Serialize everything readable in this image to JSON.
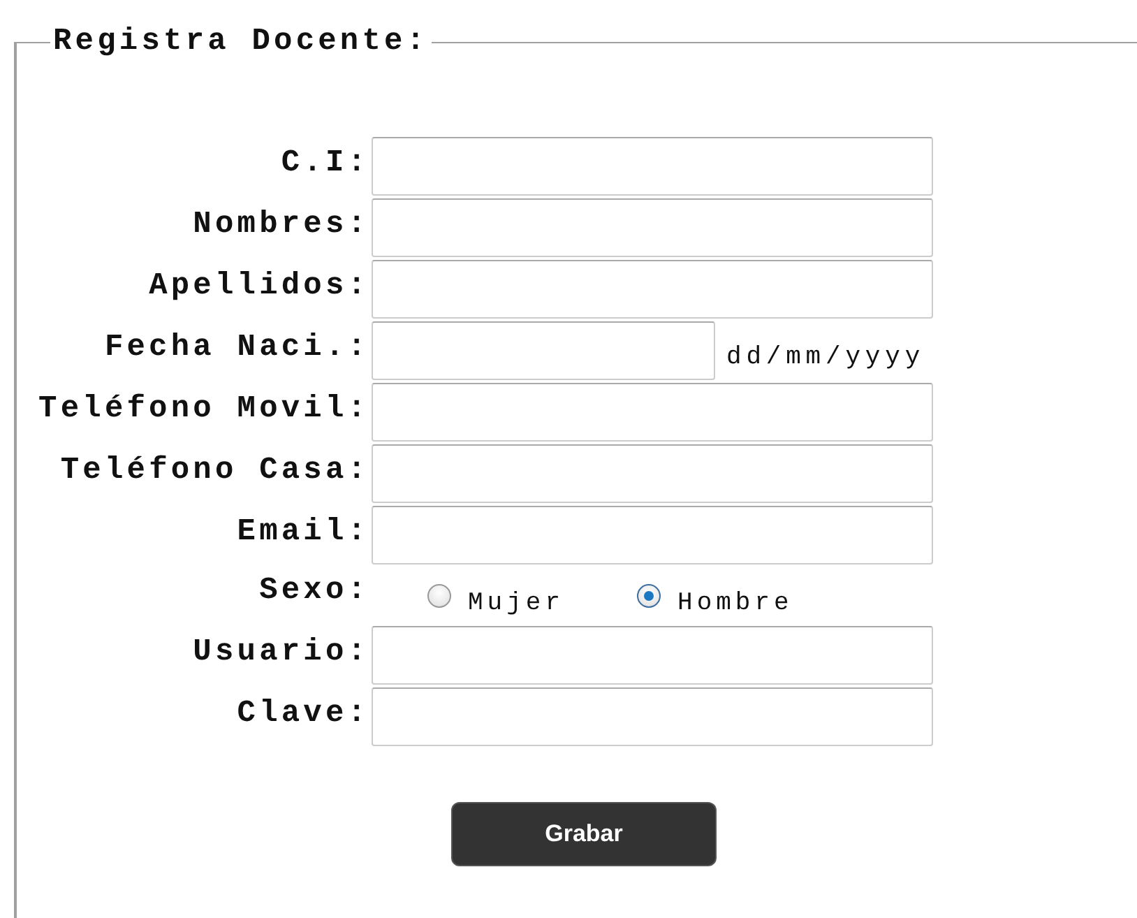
{
  "form": {
    "legend": "Registra Docente:",
    "fields": [
      {
        "kind": "text",
        "label": "C.I:"
      },
      {
        "kind": "text",
        "label": "Nombres:"
      },
      {
        "kind": "text",
        "label": "Apellidos:"
      },
      {
        "kind": "date",
        "label": "Fecha Naci.:",
        "hint": "dd/mm/yyyy"
      },
      {
        "kind": "text",
        "label": "Teléfono Movil:"
      },
      {
        "kind": "text",
        "label": "Teléfono Casa:"
      },
      {
        "kind": "text",
        "label": "Email:"
      },
      {
        "kind": "radio",
        "label": "Sexo:",
        "options": [
          {
            "label": "Mujer",
            "selected": false
          },
          {
            "label": "Hombre",
            "selected": true
          }
        ]
      },
      {
        "kind": "text",
        "label": "Usuario:"
      },
      {
        "kind": "text",
        "label": "Clave:"
      }
    ],
    "submit": "Grabar"
  }
}
